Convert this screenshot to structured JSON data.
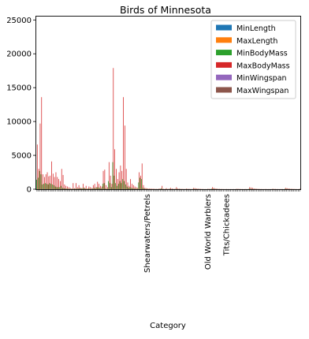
{
  "chart_data": {
    "type": "bar",
    "title": "Birds of Minnesota",
    "xlabel": "Category",
    "ylabel": "",
    "ylim": [
      0,
      25500
    ],
    "yticks": [
      0,
      5000,
      10000,
      15000,
      20000,
      25000
    ],
    "ytick_labels": [
      "0",
      "5000",
      "10000",
      "15000",
      "20000",
      "25000"
    ],
    "grid": false,
    "legend_position": "top-right",
    "readable_category_labels": [
      "Shearwaters/Petrels",
      "Tits/Chickadees",
      "Old World Warblers"
    ],
    "series": [
      {
        "name": "MinLength",
        "color": "#1f77b4"
      },
      {
        "name": "MaxLength",
        "color": "#ff7f0e"
      },
      {
        "name": "MinBodyMass",
        "color": "#2ca02c"
      },
      {
        "name": "MaxBodyMass",
        "color": "#d62728"
      },
      {
        "name": "MinWingspan",
        "color": "#9467bd"
      },
      {
        "name": "MaxWingspan",
        "color": "#8c564b"
      }
    ],
    "max_body_mass": [
      6600,
      3000,
      9700,
      13600,
      2200,
      1800,
      2200,
      2500,
      1900,
      2000,
      4100,
      2300,
      1800,
      2500,
      1800,
      1500,
      1200,
      3000,
      2100,
      700,
      500,
      400,
      300,
      200,
      100,
      900,
      150,
      900,
      300,
      600,
      250,
      150,
      800,
      200,
      500,
      100,
      400,
      300,
      200,
      600,
      800,
      300,
      1100,
      800,
      500,
      400,
      2700,
      2900,
      600,
      300,
      4000,
      2000,
      800,
      17900,
      5900,
      3000,
      1500,
      2500,
      3500,
      2700,
      13600,
      9400,
      3000,
      1000,
      500,
      1500,
      800,
      600,
      400,
      300,
      200,
      2500,
      2000,
      3800,
      600,
      200,
      150,
      120,
      100,
      90,
      80,
      70,
      60,
      50,
      40,
      100,
      80,
      500,
      60,
      50,
      150,
      40,
      80,
      200,
      100,
      60,
      50,
      300,
      100,
      80,
      60,
      50,
      40,
      30,
      90,
      60,
      50,
      40,
      30,
      200,
      150,
      100,
      80,
      60,
      50,
      40,
      30,
      25,
      20,
      60,
      50,
      40,
      300,
      200,
      100,
      80,
      60,
      50,
      40,
      30,
      25,
      20,
      30,
      25,
      20,
      25,
      20,
      25,
      20,
      60,
      50,
      40,
      30,
      25,
      20,
      30,
      25,
      20,
      300,
      250,
      200,
      100,
      80,
      60,
      50,
      40,
      30,
      25,
      20,
      30,
      25,
      20,
      25,
      20,
      60,
      50,
      40,
      30,
      25,
      20,
      30,
      25,
      20,
      200,
      150,
      100,
      80,
      60,
      50,
      40,
      30,
      25,
      20,
      60
    ],
    "min_body_mass": [
      1400,
      1700,
      2700,
      2200,
      700,
      800,
      900,
      800,
      700,
      900,
      800,
      700,
      600,
      400,
      300,
      300,
      300,
      500,
      200,
      150,
      100,
      100,
      80,
      60,
      50,
      60,
      70,
      80,
      90,
      100,
      120,
      100,
      150,
      200,
      80,
      40,
      100,
      80,
      60,
      100,
      200,
      80,
      300,
      250,
      200,
      150,
      800,
      900,
      100,
      50,
      1200,
      900,
      300,
      4000,
      2000,
      900,
      500,
      800,
      1200,
      900,
      1500,
      1200,
      700,
      400,
      200,
      300,
      200,
      150,
      100,
      80,
      60,
      1000,
      1700,
      1500,
      200,
      80,
      50,
      40,
      30,
      25,
      20,
      20,
      20,
      20,
      20,
      30,
      25,
      150,
      20,
      15,
      40,
      12,
      25,
      50,
      30,
      20,
      15,
      60,
      30,
      25,
      20,
      15,
      12,
      10,
      25,
      20,
      15,
      12,
      10,
      50,
      40,
      30,
      25,
      20,
      15,
      12,
      10,
      8,
      6,
      20,
      15,
      12,
      80,
      60,
      30,
      25,
      20,
      15,
      12,
      10,
      8,
      6,
      10,
      8,
      6,
      8,
      6,
      8,
      6,
      20,
      15,
      12,
      10,
      8,
      6,
      10,
      8,
      6,
      80,
      60,
      50,
      30,
      25,
      20,
      15,
      12,
      10,
      8,
      6,
      10,
      8,
      6,
      8,
      6,
      20,
      15,
      12,
      10,
      8,
      6,
      10,
      8,
      6,
      60,
      40,
      30,
      25,
      20,
      15,
      12,
      10,
      8,
      6,
      20
    ]
  }
}
